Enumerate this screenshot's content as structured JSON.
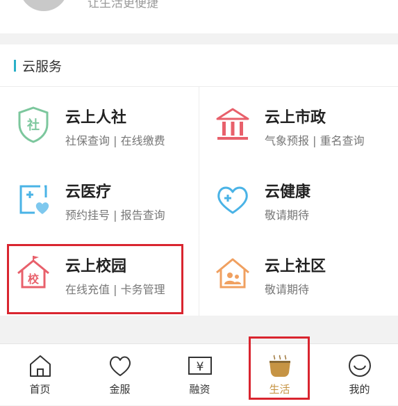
{
  "header": {
    "tagline": "让生活更便捷"
  },
  "section": {
    "title": "云服务",
    "services": [
      {
        "name": "云上人社",
        "sub": "社保查询 | 在线缴费",
        "icon": "shield-icon",
        "icon_text": "社",
        "color": "#7cc79d"
      },
      {
        "name": "云上市政",
        "sub": "气象预报 | 重名查询",
        "icon": "government-building-icon",
        "color": "#e8606b"
      },
      {
        "name": "云医疗",
        "sub": "预约挂号 | 报告查询",
        "icon": "medical-heart-icon",
        "color": "#4ab3e6"
      },
      {
        "name": "云健康",
        "sub": "敬请期待",
        "icon": "heart-plus-icon",
        "color": "#4ab3e6"
      },
      {
        "name": "云上校园",
        "sub": "在线充值 | 卡务管理",
        "icon": "school-icon",
        "icon_text": "校",
        "color": "#e8606b"
      },
      {
        "name": "云上社区",
        "sub": "敬请期待",
        "icon": "community-house-icon",
        "color": "#f0a060"
      }
    ]
  },
  "tabbar": {
    "tabs": [
      {
        "label": "首页",
        "icon": "home-icon"
      },
      {
        "label": "金服",
        "icon": "heart-outline-icon"
      },
      {
        "label": "融资",
        "icon": "yuan-box-icon",
        "icon_text": "¥"
      },
      {
        "label": "生活",
        "icon": "tea-cup-icon",
        "active": true
      },
      {
        "label": "我的",
        "icon": "smiley-icon"
      }
    ]
  },
  "colors": {
    "accent": "#2ab0c8",
    "highlight": "#d9252f",
    "active_tab": "#c69444"
  }
}
